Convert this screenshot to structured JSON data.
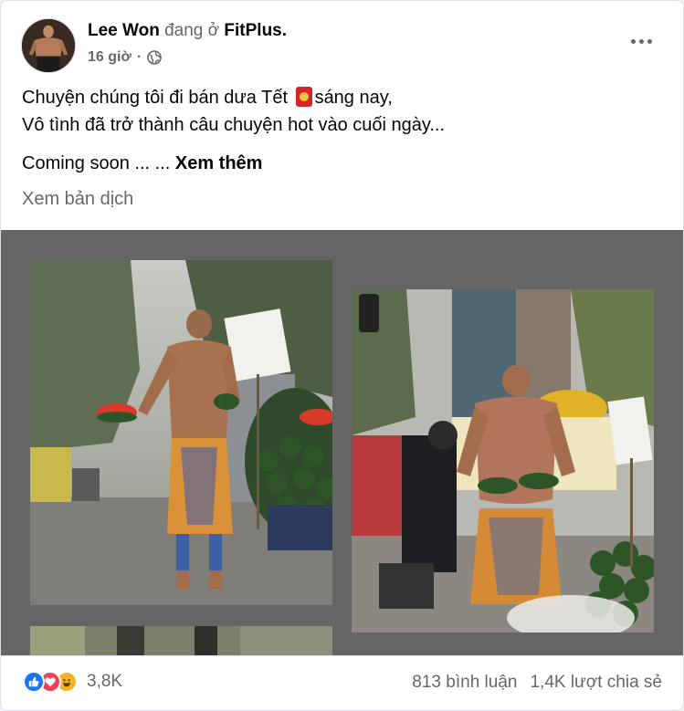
{
  "post": {
    "author": "Lee Won",
    "checkin_text": "đang ở",
    "place": "FitPlus.",
    "time": "16 giờ",
    "time_separator": "·",
    "privacy_icon": "globe-icon",
    "more_icon": "more-horizontal-icon",
    "text_line1_a": "Chuyện chúng tôi đi bán dưa Tết",
    "text_line1_emoji": "red-envelope-icon",
    "text_line1_b": "sáng nay,",
    "text_line2": "Vô tình đã trở thành câu chuyện hot vào cuối ngày...",
    "text_line3": "Coming soon ... ...",
    "see_more": "Xem thêm",
    "see_translation": "Xem bản dịch"
  },
  "gallery": {
    "background": "#656565",
    "photos": [
      "photo-1",
      "photo-2",
      "photo-3"
    ]
  },
  "footer": {
    "reaction_icons": [
      "like-icon",
      "love-icon",
      "haha-icon"
    ],
    "reaction_count": "3,8K",
    "comments": "813 bình luận",
    "shares": "1,4K lượt chia sẻ"
  },
  "colors": {
    "like": "#1877f2",
    "love": "#f33e58",
    "haha": "#f7b125",
    "secondary_text": "#65676b"
  }
}
